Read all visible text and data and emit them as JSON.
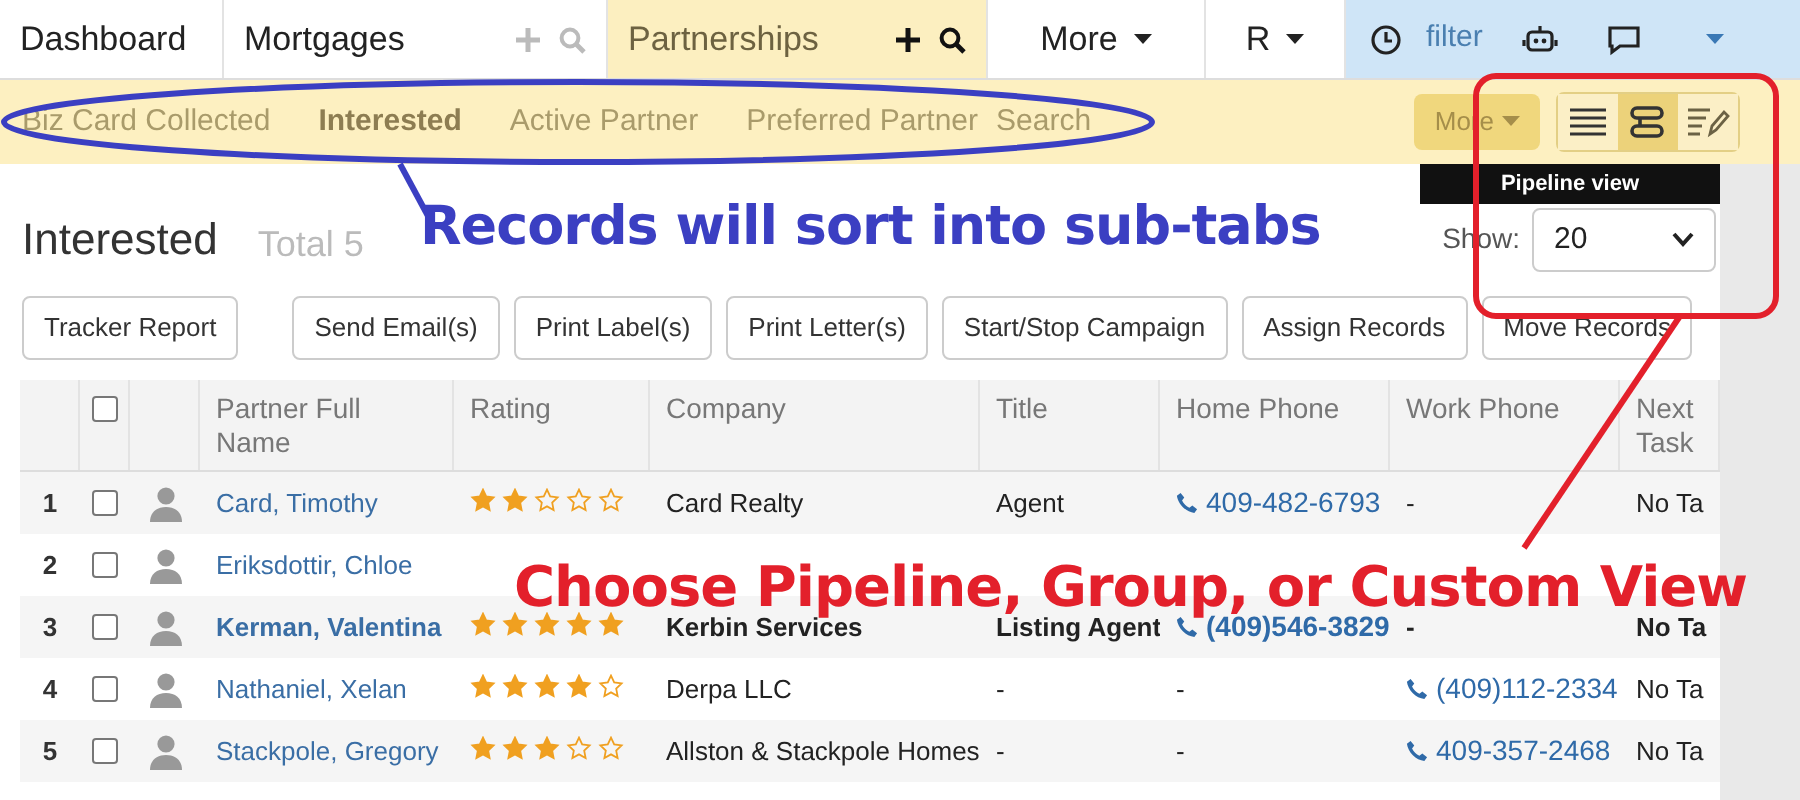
{
  "nav": {
    "tabs": [
      {
        "label": "Dashboard",
        "selected": false,
        "kind": "plain"
      },
      {
        "label": "Mortgages",
        "selected": false,
        "kind": "addsearch"
      },
      {
        "label": "Partnerships",
        "selected": true,
        "kind": "addsearch"
      },
      {
        "label": "More",
        "selected": false,
        "kind": "dropdown"
      },
      {
        "label": "R",
        "selected": false,
        "kind": "dropdown"
      }
    ],
    "filter": "filter"
  },
  "subtabs": [
    {
      "label": "Biz Card Collected",
      "selected": false
    },
    {
      "label": "Interested",
      "selected": true
    },
    {
      "label": "Active Partner",
      "selected": false
    },
    {
      "label": "Preferred Partner",
      "selected": false
    },
    {
      "label": "Search",
      "selected": false
    }
  ],
  "more_button": "More",
  "view_buttons": [
    {
      "kind": "list",
      "selected": false
    },
    {
      "kind": "pipeline",
      "selected": true
    },
    {
      "kind": "custom",
      "selected": false
    }
  ],
  "tooltip": "Pipeline view",
  "heading": "Interested",
  "total": "Total 5",
  "show_label": "Show:",
  "show_value": "20",
  "actions": [
    "Tracker Report",
    "Send Email(s)",
    "Print Label(s)",
    "Print Letter(s)",
    "Start/Stop Campaign",
    "Assign Records",
    "Move Records"
  ],
  "table": {
    "header_checked": false,
    "columns": [
      "Partner Full Name",
      "Rating",
      "Company",
      "Title",
      "Home Phone",
      "Work Phone",
      "Next Task"
    ],
    "rows": [
      {
        "number": "1",
        "checked": false,
        "bold": false,
        "name": "Card, Timothy",
        "stars": 2,
        "company": "Card Realty",
        "title": "Agent",
        "home_phone": {
          "kind": "phone",
          "text": "409-482-6793"
        },
        "work_phone": {
          "kind": "plain",
          "text": "-"
        },
        "next_task": "No Ta"
      },
      {
        "number": "2",
        "checked": false,
        "bold": false,
        "name": "Eriksdottir, Chloe"
      },
      {
        "number": "3",
        "checked": false,
        "bold": true,
        "name": "Kerman, Valentina",
        "stars": 5,
        "company": "Kerbin Services",
        "title": "Listing Agent",
        "home_phone": {
          "kind": "phone",
          "text": "(409)546-3829"
        },
        "work_phone": {
          "kind": "plain",
          "text": "-"
        },
        "next_task": "No Ta"
      },
      {
        "number": "4",
        "checked": false,
        "bold": false,
        "name": "Nathaniel, Xelan",
        "stars": 4,
        "company": "Derpa LLC",
        "title": "-",
        "home_phone": {
          "kind": "plain",
          "text": "-"
        },
        "work_phone": {
          "kind": "phone",
          "text": "(409)112-2334"
        },
        "next_task": "No Ta"
      },
      {
        "number": "5",
        "checked": false,
        "bold": false,
        "name": "Stackpole, Gregory",
        "stars": 3,
        "company": "Allston & Stackpole Homes",
        "title": "-",
        "home_phone": {
          "kind": "plain",
          "text": "-"
        },
        "work_phone": {
          "kind": "phone",
          "text": "409-357-2468"
        },
        "next_task": "No Ta"
      }
    ]
  },
  "annotations": [
    {
      "text": "Records will sort into sub-tabs",
      "color": "#3b3fc2"
    },
    {
      "text": "Choose Pipeline, Group, or Custom View",
      "color": "#e3202b"
    }
  ]
}
